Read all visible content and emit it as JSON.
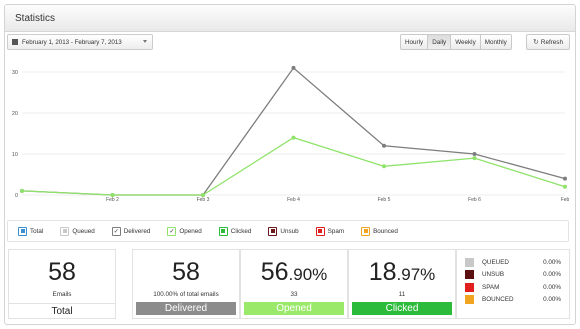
{
  "header": {
    "title": "Statistics"
  },
  "toolbar": {
    "date_range": "February 1, 2013 - February 7, 2013",
    "granularity": [
      {
        "label": "Hourly",
        "active": false
      },
      {
        "label": "Daily",
        "active": true
      },
      {
        "label": "Weekly",
        "active": false
      },
      {
        "label": "Monthly",
        "active": false
      }
    ],
    "refresh_label": "Refresh"
  },
  "chart_data": {
    "type": "line",
    "x": [
      "",
      "Feb 2",
      "Feb 3",
      "Feb 4",
      "Feb 5",
      "Feb 6",
      "Feb"
    ],
    "ylim": [
      0,
      30
    ],
    "yticks": [
      0,
      10,
      20,
      30
    ],
    "grid": true,
    "series": [
      {
        "color": "#7d7d7d",
        "values": [
          1,
          0,
          0,
          31,
          12,
          10,
          4
        ]
      },
      {
        "color": "#8fe36a",
        "values": [
          1,
          0,
          0,
          14,
          7,
          9,
          2
        ]
      }
    ]
  },
  "legend": [
    {
      "label": "Total",
      "color": "#3a8fd1",
      "checked": false
    },
    {
      "label": "Queued",
      "color": "#c8c8c8",
      "checked": false
    },
    {
      "label": "Delivered",
      "color": "#7d7d7d",
      "checked": true
    },
    {
      "label": "Opened",
      "color": "#8fe36a",
      "checked": true
    },
    {
      "label": "Clicked",
      "color": "#2dbb3c",
      "checked": false
    },
    {
      "label": "Unsub",
      "color": "#6b1a1a",
      "checked": false
    },
    {
      "label": "Spam",
      "color": "#e21f1f",
      "checked": false
    },
    {
      "label": "Bounced",
      "color": "#f0a420",
      "checked": false
    }
  ],
  "cards": {
    "total": {
      "value": "58",
      "sub": "Emails",
      "label": "Total"
    },
    "delivered": {
      "value": "58",
      "sub": "100.00% of total emails",
      "label": "Delivered",
      "color": "#8c8c8c"
    },
    "opened": {
      "value_int": "56",
      "value_dec": ".90%",
      "sub": "33",
      "label": "Opened",
      "color": "#9ae96b"
    },
    "clicked": {
      "value_int": "18",
      "value_dec": ".97%",
      "sub": "11",
      "label": "Clicked",
      "color": "#2dbb3c"
    }
  },
  "status": [
    {
      "label": "QUEUED",
      "value": "0.00%",
      "color": "#c8c8c8"
    },
    {
      "label": "UNSUB",
      "value": "0.00%",
      "color": "#5a1010"
    },
    {
      "label": "SPAM",
      "value": "0.00%",
      "color": "#e21f1f"
    },
    {
      "label": "BOUNCED",
      "value": "0.00%",
      "color": "#f0a420"
    }
  ]
}
